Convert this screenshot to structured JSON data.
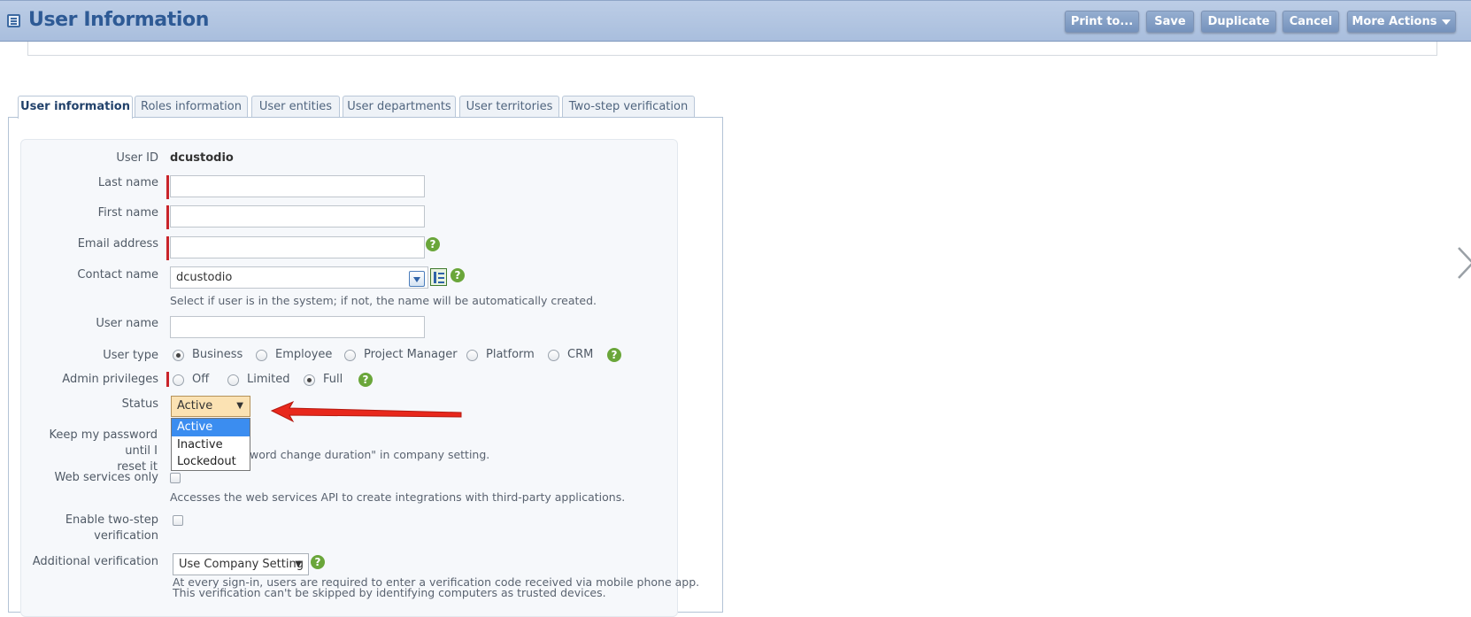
{
  "header": {
    "title": "User Information",
    "buttons": {
      "print": "Print to...",
      "save": "Save",
      "duplicate": "Duplicate",
      "cancel": "Cancel",
      "more_actions": "More Actions"
    }
  },
  "tabs": [
    {
      "label": "User information"
    },
    {
      "label": "Roles information"
    },
    {
      "label": "User entities"
    },
    {
      "label": "User departments"
    },
    {
      "label": "User territories"
    },
    {
      "label": "Two-step verification"
    }
  ],
  "form": {
    "user_id": {
      "label": "User ID",
      "value": "dcustodio"
    },
    "last_name": {
      "label": "Last name",
      "value": ""
    },
    "first_name": {
      "label": "First name",
      "value": ""
    },
    "email": {
      "label": "Email address",
      "value": ""
    },
    "contact": {
      "label": "Contact name",
      "value": "dcustodio",
      "hint": "Select if user is in the system; if not, the name will be automatically created."
    },
    "user_name": {
      "label": "User name",
      "value": ""
    },
    "user_type": {
      "label": "User type",
      "options": [
        "Business",
        "Employee",
        "Project Manager",
        "Platform",
        "CRM"
      ],
      "selected": "Business"
    },
    "admin": {
      "label": "Admin privileges",
      "options": [
        "Off",
        "Limited",
        "Full"
      ],
      "selected": "Full"
    },
    "status": {
      "label": "Status",
      "value": "Active",
      "options": [
        "Active",
        "Inactive",
        "Lockedout"
      ],
      "highlighted": "Active"
    },
    "keep_password": {
      "label_line1": "Keep my password until I",
      "label_line2": "reset it",
      "hint": "word change duration\" in company setting."
    },
    "web_services": {
      "label": "Web services only",
      "hint": "Accesses the web services API to create integrations with third-party applications."
    },
    "two_step": {
      "label_line1": "Enable two-step",
      "label_line2": "verification"
    },
    "additional_verification": {
      "label": "Additional verification",
      "value": "Use Company Setting",
      "hint_line1": "At every sign-in, users are required to enter a verification code received via mobile phone app.",
      "hint_line2": "This verification can't be skipped by identifying computers as trusted devices."
    }
  },
  "icons": {
    "help": "?",
    "title": "list-icon",
    "prev": "chevron-left-icon",
    "next": "chevron-right-icon"
  },
  "colors": {
    "header_bg": "#a9bedd",
    "title": "#2e5a95",
    "required_marker": "#c9242a",
    "help_icon": "#6aa63a",
    "status_select_bg": "#fbe2b3",
    "dropdown_highlight": "#3b8df0",
    "annotation_arrow": "#e8281c"
  }
}
